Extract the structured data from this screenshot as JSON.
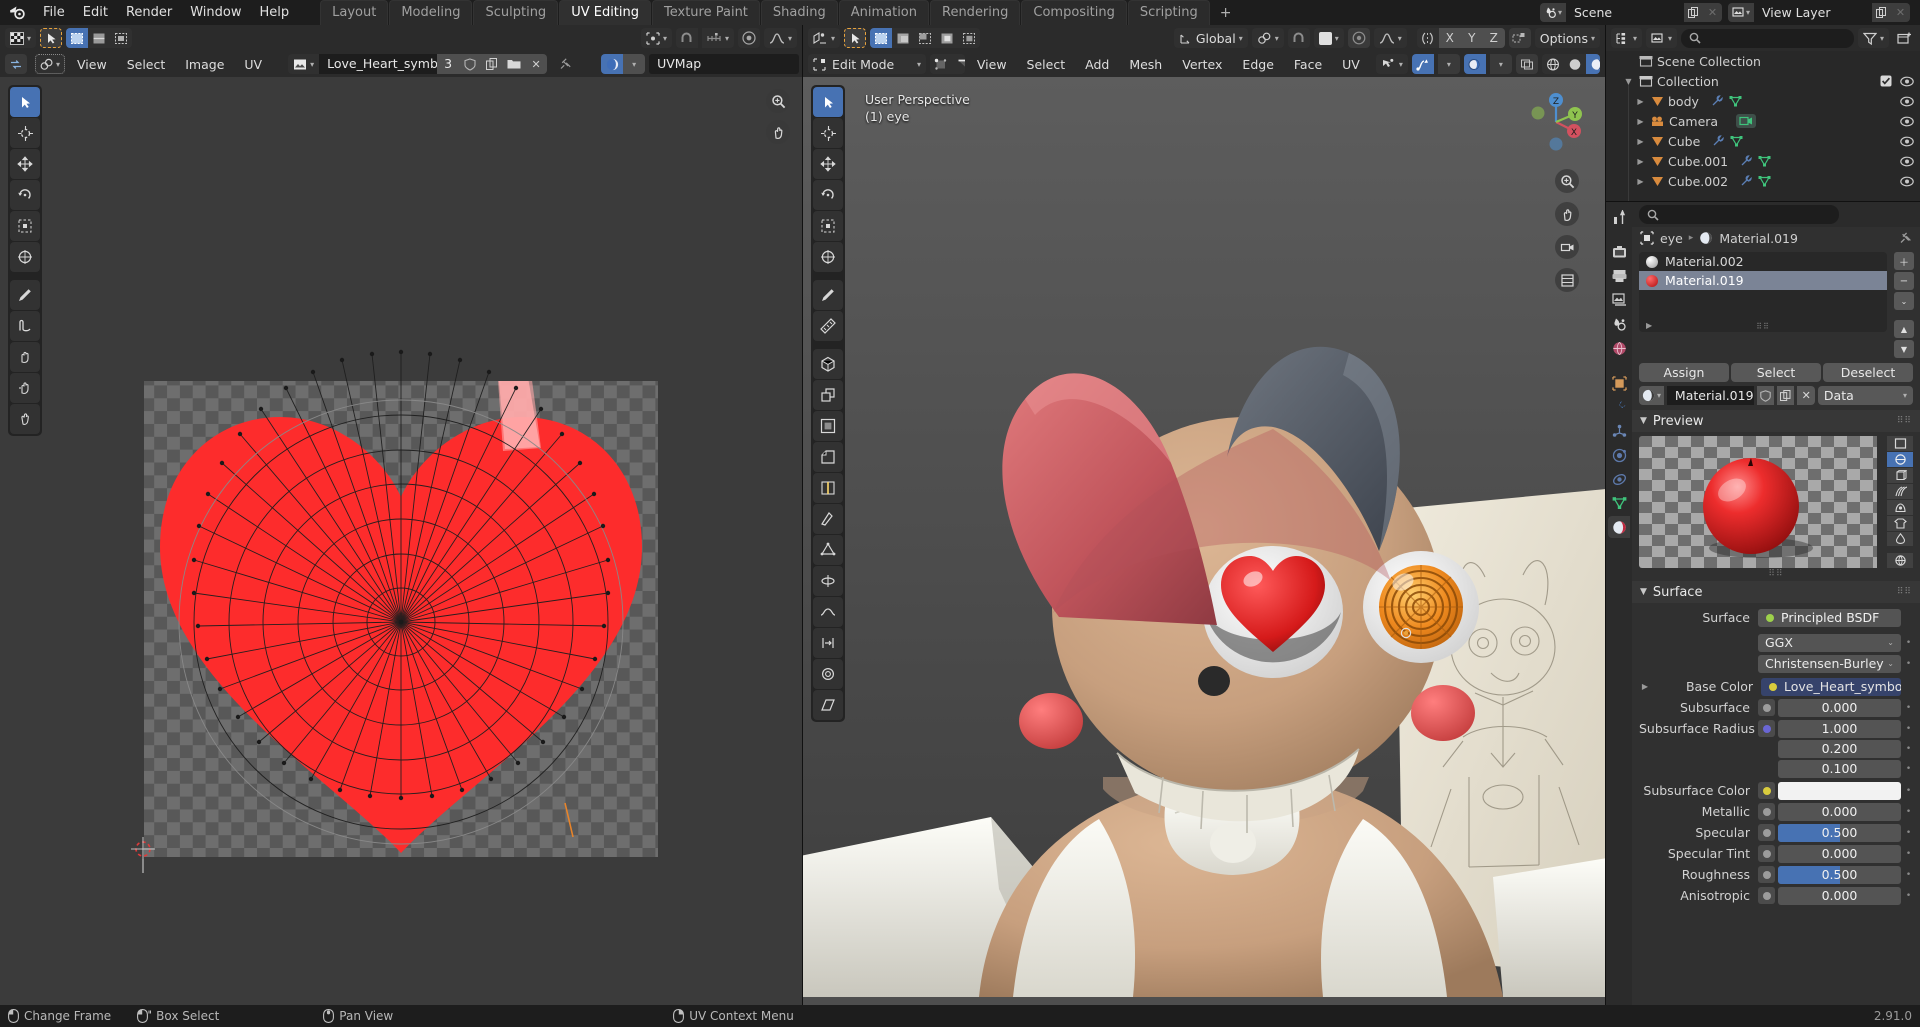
{
  "app": {
    "version": "2.91.0",
    "accent_blue": "#4772b3",
    "accent_orange": "#e8a33d",
    "bg_dark": "#1d1d1d",
    "bg_header": "#2b2b2b",
    "bg_panel": "#303030"
  },
  "topbar": {
    "logo_icon": "blender-logo-icon",
    "menus": [
      "File",
      "Edit",
      "Render",
      "Window",
      "Help"
    ],
    "workspace_tabs": [
      {
        "label": "Layout",
        "active": false
      },
      {
        "label": "Modeling",
        "active": false
      },
      {
        "label": "Sculpting",
        "active": false
      },
      {
        "label": "UV Editing",
        "active": true
      },
      {
        "label": "Texture Paint",
        "active": false
      },
      {
        "label": "Shading",
        "active": false
      },
      {
        "label": "Animation",
        "active": false
      },
      {
        "label": "Rendering",
        "active": false
      },
      {
        "label": "Compositing",
        "active": false
      },
      {
        "label": "Scripting",
        "active": false
      }
    ],
    "add_workspace_label": "+",
    "scene": {
      "icon": "scene-icon",
      "name": "Scene",
      "copy_icon": "duplicate-icon",
      "close_icon": "x-icon"
    },
    "view_layer": {
      "icon": "view-layer-icon",
      "name": "View Layer",
      "copy_icon": "duplicate-icon",
      "close_icon": "x-icon"
    }
  },
  "uv_editor": {
    "editor_type_icon": "uv-editor-icon",
    "mode_icon": "cursor-select-icon",
    "uv_select_modes": [
      "vertex-select-icon",
      "edge-select-icon",
      "face-select-icon"
    ],
    "pivot_icon": "pivot-icon",
    "snap_icon": "magnet-icon",
    "snap_target_icon": "snap-increment-icon",
    "proportional_icon": "proportional-edit-icon",
    "falloff_icon": "smooth-falloff-icon",
    "uv_sync_icon": "uv-sync-icon",
    "sticky_modes": [
      "sticky-shared-location-icon",
      "sticky-shared-vertex-icon",
      "sticky-disabled-icon"
    ],
    "menus": [
      "View",
      "Select",
      "Image",
      "UV"
    ],
    "image_block": {
      "browse_icon": "image-browse-icon",
      "name": "Love_Heart_symbol....",
      "users": "3",
      "fake_user_icon": "shield-icon",
      "new_icon": "duplicate-icon",
      "open_icon": "folder-icon",
      "unlink_icon": "x-icon",
      "pin_icon": "pin-icon"
    },
    "uvmap_block": {
      "icon": "uvmap-icon",
      "name": "UVMap"
    },
    "toolbar": [
      {
        "icon": "tweak-tool-icon",
        "active": true
      },
      {
        "icon": "cursor-tool-icon",
        "active": false
      },
      {
        "icon": "move-tool-icon",
        "active": false
      },
      {
        "icon": "rotate-tool-icon",
        "active": false
      },
      {
        "icon": "scale-tool-icon",
        "active": false
      },
      {
        "icon": "transform-tool-icon",
        "active": false
      },
      {
        "icon": "annotate-tool-icon",
        "active": false
      },
      {
        "icon": "rip-region-tool-icon",
        "active": false
      },
      {
        "icon": "grab-tool-icon",
        "active": false
      },
      {
        "icon": "relax-tool-icon",
        "active": false
      },
      {
        "icon": "pinch-tool-icon",
        "active": false
      }
    ],
    "nav_icons": [
      "zoom-region-icon",
      "pan-view-icon"
    ],
    "image_content": {
      "description": "Love heart symbol UV texture with radial UV mesh wireframe overlay",
      "heart_color": "#fd2c2c",
      "checker_a": "#6e6e6e",
      "checker_b": "#575757"
    }
  },
  "viewport": {
    "editor_type_icon": "3d-viewport-icon",
    "mode": "Edit Mode",
    "mode_icon": "edit-mode-icon",
    "mesh_select_modes": [
      "vertex-select-icon",
      "edge-select-icon",
      "face-select-icon"
    ],
    "active_select_mode": 2,
    "select_tool_icons": [
      "select-set-icon",
      "select-extend-icon",
      "select-subtract-icon",
      "select-invert-icon",
      "select-intersect-icon"
    ],
    "menus": [
      "View",
      "Select",
      "Add",
      "Mesh",
      "Vertex",
      "Edge",
      "Face",
      "UV"
    ],
    "transform_orientation": "Global",
    "snap_icon": "magnet-icon",
    "proportional_icon": "proportional-edit-icon",
    "falloff_icon": "smooth-falloff-icon",
    "mirror_icon": "mirror-icon",
    "mirror_axes": [
      "X",
      "Y",
      "Z"
    ],
    "uv_mirror_icon": "uv-mirror-icon",
    "options_label": "Options",
    "overlay_visibility_icon": "show-hide-icon",
    "gizmo_icon": "gizmo-icon",
    "overlays_icon": "overlays-icon",
    "xray_icon": "xray-icon",
    "shading_modes": [
      "wireframe-icon",
      "solid-icon",
      "material-preview-icon",
      "rendered-icon"
    ],
    "active_shading_mode": 2,
    "header_text_line1": "User Perspective",
    "header_text_line2": "(1) eye",
    "gizmo_axes": {
      "x": "#d3515f",
      "y": "#8fc44f",
      "z": "#4e8fd0"
    },
    "nav_buttons": [
      "zoom-icon",
      "pan-icon",
      "camera-view-icon",
      "toggle-ortho-icon"
    ],
    "toolbar": [
      {
        "icon": "tweak-tool-icon",
        "active": true
      },
      {
        "icon": "cursor-tool-icon",
        "active": false
      },
      {
        "icon": "move-tool-icon",
        "active": false
      },
      {
        "icon": "rotate-tool-icon",
        "active": false
      },
      {
        "icon": "scale-tool-icon",
        "active": false
      },
      {
        "icon": "transform-tool-icon",
        "active": false
      },
      {
        "icon": "annotate-tool-icon",
        "active": false
      },
      {
        "icon": "measure-tool-icon",
        "active": false
      },
      {
        "icon": "add-cube-tool-icon",
        "active": false
      },
      {
        "icon": "extrude-region-tool-icon",
        "active": false
      },
      {
        "icon": "inset-faces-tool-icon",
        "active": false
      },
      {
        "icon": "bevel-tool-icon",
        "active": false
      },
      {
        "icon": "loop-cut-tool-icon",
        "active": false
      },
      {
        "icon": "knife-tool-icon",
        "active": false
      },
      {
        "icon": "poly-build-tool-icon",
        "active": false
      },
      {
        "icon": "spin-tool-icon",
        "active": false
      },
      {
        "icon": "smooth-tool-icon",
        "active": false
      },
      {
        "icon": "edge-slide-tool-icon",
        "active": false
      },
      {
        "icon": "shrink-fatten-tool-icon",
        "active": false
      },
      {
        "icon": "shear-tool-icon",
        "active": false
      },
      {
        "icon": "rip-region-tool-icon",
        "active": false
      }
    ],
    "scene_description": "3D model of a Five Nights at Freddy's style jester/bee character head with red and grey hat, one red heart-shaped eye and one orange spiral eye, tan skin, rosy cheeks, white bow tie, plus a pencil concept sketch reference plane behind"
  },
  "outliner": {
    "display_mode_icon": "outliner-display-mode-icon",
    "filter_id_icon": "view-layer-icon",
    "search_placeholder": "",
    "search_icon": "search-icon",
    "filter_icon": "filter-funnel-icon",
    "new_collection_icon": "new-collection-icon",
    "rows": [
      {
        "label": "Scene Collection",
        "icon": "scene-collection-icon",
        "indent": 0,
        "disclosure": "",
        "has_checkbox": false,
        "has_eye": false
      },
      {
        "label": "Collection",
        "icon": "collection-icon",
        "indent": 1,
        "disclosure": "down",
        "has_checkbox": true,
        "has_eye": true
      },
      {
        "label": "body",
        "icon": "mesh-object-icon",
        "indent": 2,
        "disclosure": "right",
        "has_checkbox": false,
        "has_eye": true,
        "data_icons": [
          "modifier-icon",
          "mesh-data-icon"
        ]
      },
      {
        "label": "Camera",
        "icon": "camera-object-icon",
        "indent": 2,
        "disclosure": "right",
        "has_checkbox": false,
        "has_eye": true,
        "data_icons": [
          "camera-data-icon"
        ]
      },
      {
        "label": "Cube",
        "icon": "mesh-object-icon",
        "indent": 2,
        "disclosure": "right",
        "has_checkbox": false,
        "has_eye": true,
        "data_icons": [
          "modifier-icon",
          "mesh-data-icon"
        ]
      },
      {
        "label": "Cube.001",
        "icon": "mesh-object-icon",
        "indent": 2,
        "disclosure": "right",
        "has_checkbox": false,
        "has_eye": true,
        "data_icons": [
          "modifier-icon",
          "mesh-data-icon"
        ]
      },
      {
        "label": "Cube.002",
        "icon": "mesh-object-icon",
        "indent": 2,
        "disclosure": "right",
        "has_checkbox": false,
        "has_eye": true,
        "data_icons": [
          "modifier-icon",
          "mesh-data-icon"
        ]
      }
    ]
  },
  "properties": {
    "editor_type_icon": "properties-editor-icon",
    "search_placeholder": "",
    "search_icon": "search-icon",
    "tabs": [
      {
        "icon": "tool-icon",
        "active": false
      },
      {
        "icon": "render-properties-icon",
        "active": false
      },
      {
        "icon": "output-properties-icon",
        "active": false
      },
      {
        "icon": "view-layer-properties-icon",
        "active": false
      },
      {
        "icon": "scene-properties-icon",
        "active": false
      },
      {
        "icon": "world-properties-icon",
        "active": false
      },
      {
        "icon": "object-properties-icon",
        "active": false
      },
      {
        "icon": "modifier-properties-icon",
        "active": false
      },
      {
        "icon": "particle-properties-icon",
        "active": false
      },
      {
        "icon": "physics-properties-icon",
        "active": false
      },
      {
        "icon": "constraint-properties-icon",
        "active": false
      },
      {
        "icon": "object-data-properties-icon",
        "active": false
      },
      {
        "icon": "material-properties-icon",
        "active": true
      }
    ],
    "breadcrumb": {
      "object_icon": "object-icon",
      "object": "eye",
      "separator": "▸",
      "material_icon": "material-icon",
      "material": "Material.019",
      "pin_icon": "pin-icon"
    },
    "material_slots": [
      {
        "name": "Material.002",
        "color": "#d8d8d8",
        "selected": false
      },
      {
        "name": "Material.019",
        "color": "#e02020",
        "selected": true
      }
    ],
    "slot_buttons": [
      "plus-icon",
      "minus-icon",
      "specials-dropdown-icon",
      "move-up-icon",
      "move-down-icon"
    ],
    "slot_specials_expand": "▸",
    "action_buttons": [
      "Assign",
      "Select",
      "Deselect"
    ],
    "material_block": {
      "browse_icon": "material-browse-icon",
      "name": "Material.019",
      "fake_user_icon": "shield-icon",
      "new_icon": "duplicate-icon",
      "unlink_icon": "x-icon",
      "link_dropdown": "Data"
    },
    "preview_panel": {
      "title": "Preview",
      "collapse_icon": "triangle-down-icon",
      "grip_icon": "grip-icon",
      "render_types": [
        "flat-preview-icon",
        "sphere-preview-icon",
        "cube-preview-icon",
        "hair-preview-icon",
        "shader-ball-preview-icon",
        "cloth-preview-icon",
        "fluid-preview-icon",
        "world-preview-icon"
      ],
      "active_render_type": 1
    },
    "surface_panel": {
      "title": "Surface",
      "collapse_icon": "triangle-down-icon",
      "grip_icon": "grip-icon",
      "rows": [
        {
          "kind": "node",
          "label": "Surface",
          "value": "Principled BSDF",
          "socket": "#9dd14b",
          "expand": false
        },
        {
          "kind": "dropdown",
          "label": "",
          "value": "GGX",
          "dot": true
        },
        {
          "kind": "dropdown",
          "label": "",
          "value": "Christensen-Burley",
          "dot": true
        },
        {
          "kind": "linked",
          "label": "Base Color",
          "value": "Love_Heart_symbol.svg.png",
          "socket": "#d9cc3d",
          "expand": true,
          "dot": false
        },
        {
          "kind": "slider",
          "label": "Subsurface",
          "value": "0.000",
          "fill": 0,
          "socket": "#9c9c9c",
          "dot": true
        },
        {
          "kind": "slider",
          "label": "Subsurface Radius",
          "value": "1.000",
          "fill": 0,
          "socket": "#6a66d4",
          "dot": true
        },
        {
          "kind": "slider",
          "label": "",
          "value": "0.200",
          "fill": 0,
          "socket": null,
          "dot": true
        },
        {
          "kind": "slider",
          "label": "",
          "value": "0.100",
          "fill": 0,
          "socket": null,
          "dot": true
        },
        {
          "kind": "swatch",
          "label": "Subsurface Color",
          "value": "",
          "color": "#f2f2f2",
          "socket": "#d9cc3d",
          "dot": true
        },
        {
          "kind": "slider",
          "label": "Metallic",
          "value": "0.000",
          "fill": 0,
          "socket": "#9c9c9c",
          "dot": true
        },
        {
          "kind": "slider",
          "label": "Specular",
          "value": "0.500",
          "fill": 50,
          "socket": "#9c9c9c",
          "dot": true
        },
        {
          "kind": "slider",
          "label": "Specular Tint",
          "value": "0.000",
          "fill": 0,
          "socket": "#9c9c9c",
          "dot": true
        },
        {
          "kind": "slider",
          "label": "Roughness",
          "value": "0.500",
          "fill": 50,
          "socket": "#9c9c9c",
          "dot": true
        },
        {
          "kind": "slider",
          "label": "Anisotropic",
          "value": "0.000",
          "fill": 0,
          "socket": "#9c9c9c",
          "dot": true
        }
      ]
    }
  },
  "status_bar": {
    "items": [
      {
        "icon": "mouse-left-icon",
        "label": "Change Frame"
      },
      {
        "icon": "mouse-left-drag-icon",
        "label": "Box Select"
      },
      {
        "icon": "mouse-middle-icon",
        "label": "Pan View"
      },
      {
        "icon": "mouse-right-icon",
        "label": "UV Context Menu"
      }
    ],
    "version": "2.91.0"
  }
}
